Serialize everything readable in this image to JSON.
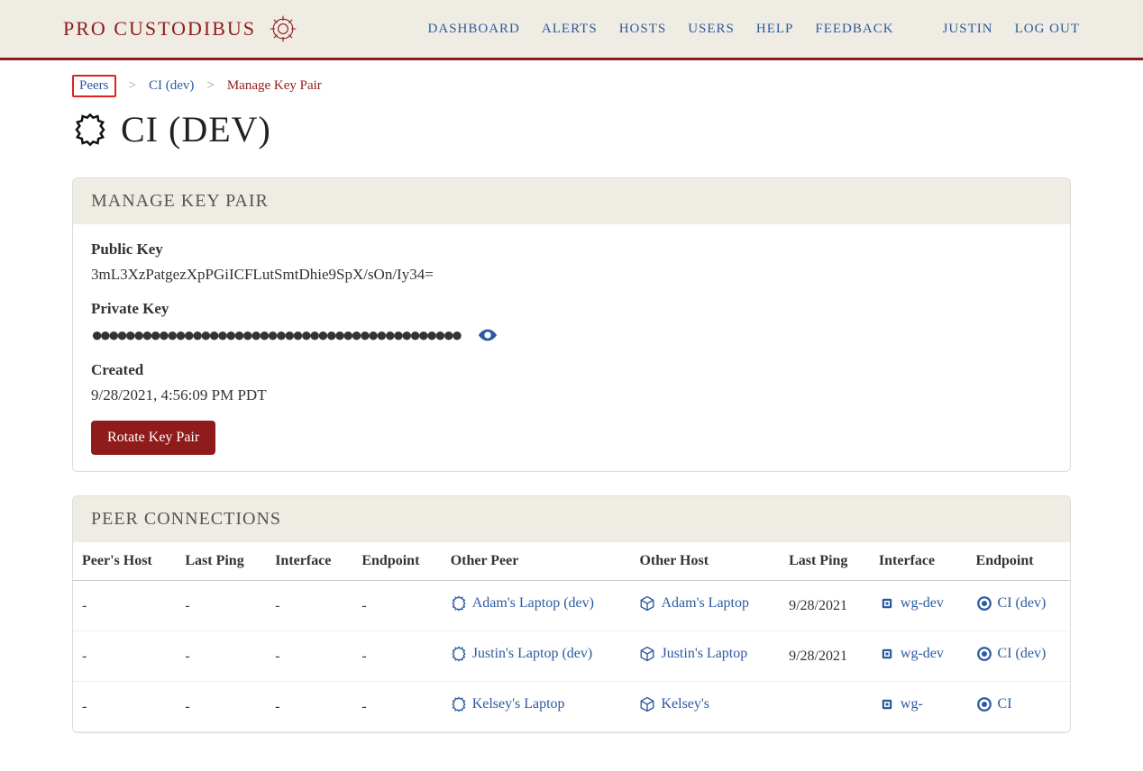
{
  "brand": "PRO CUSTODIBUS",
  "nav": {
    "dashboard": "DASHBOARD",
    "alerts": "ALERTS",
    "hosts": "HOSTS",
    "users": "USERS",
    "help": "HELP",
    "feedback": "FEEDBACK",
    "user": "JUSTIN",
    "logout": "LOG OUT"
  },
  "breadcrumb": {
    "peers": "Peers",
    "ci": "CI (dev)",
    "manage": "Manage Key Pair"
  },
  "page_title": "CI (DEV)",
  "keypair": {
    "header": "MANAGE KEY PAIR",
    "public_label": "Public Key",
    "public_value": "3mL3XzPatgezXpPGiICFLutSmtDhie9SpX/sOn/Iy34=",
    "private_label": "Private Key",
    "private_masked": "●●●●●●●●●●●●●●●●●●●●●●●●●●●●●●●●●●●●●●●●●●●●",
    "created_label": "Created",
    "created_value": "9/28/2021, 4:56:09 PM PDT",
    "rotate_button": "Rotate Key Pair"
  },
  "connections": {
    "header": "PEER CONNECTIONS",
    "columns": {
      "peers_host": "Peer's Host",
      "last_ping": "Last Ping",
      "interface": "Interface",
      "endpoint": "Endpoint",
      "other_peer": "Other Peer",
      "other_host": "Other Host",
      "last_ping2": "Last Ping",
      "interface2": "Interface",
      "endpoint2": "Endpoint"
    },
    "rows": [
      {
        "ph": "-",
        "lp": "-",
        "if": "-",
        "ep": "-",
        "op": "Adam's Laptop (dev)",
        "oh": "Adam's Laptop",
        "lp2": "9/28/2021",
        "if2": "wg-dev",
        "ep2": "CI (dev)"
      },
      {
        "ph": "-",
        "lp": "-",
        "if": "-",
        "ep": "-",
        "op": "Justin's Laptop (dev)",
        "oh": "Justin's Laptop",
        "lp2": "9/28/2021",
        "if2": "wg-dev",
        "ep2": "CI (dev)"
      },
      {
        "ph": "-",
        "lp": "-",
        "if": "-",
        "ep": "-",
        "op": "Kelsey's Laptop",
        "oh": "Kelsey's",
        "lp2": "",
        "if2": "wg-",
        "ep2": "CI"
      }
    ]
  }
}
